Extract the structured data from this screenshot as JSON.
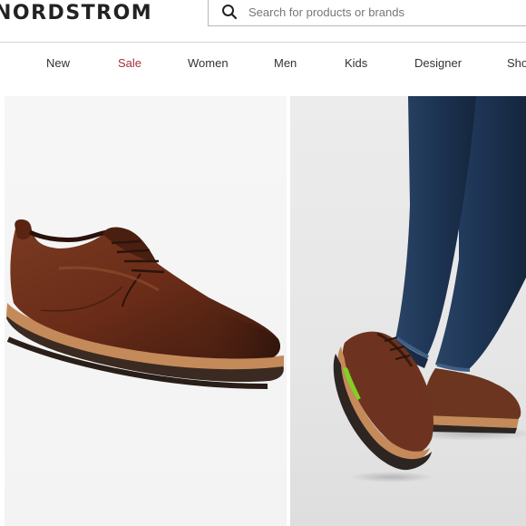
{
  "header": {
    "brand": "NORDSTROM",
    "search": {
      "placeholder": "Search for products or brands",
      "value": "",
      "icon": "search-icon"
    }
  },
  "nav": {
    "items": [
      {
        "label": "New",
        "highlight": false
      },
      {
        "label": "Sale",
        "highlight": true
      },
      {
        "label": "Women",
        "highlight": false
      },
      {
        "label": "Men",
        "highlight": false
      },
      {
        "label": "Kids",
        "highlight": false
      },
      {
        "label": "Designer",
        "highlight": false
      },
      {
        "label": "Sho",
        "highlight": false
      }
    ],
    "sale_color": "#a5303a"
  },
  "gallery": {
    "images": [
      {
        "name": "Brown leather derby shoe, side view"
      },
      {
        "name": "Model wearing brown derby shoes with jeans"
      }
    ]
  },
  "colors": {
    "leather": "#6b2f1c",
    "sole": "#c58a5a",
    "denim": "#1f3552",
    "accent_green": "#7ed321"
  }
}
